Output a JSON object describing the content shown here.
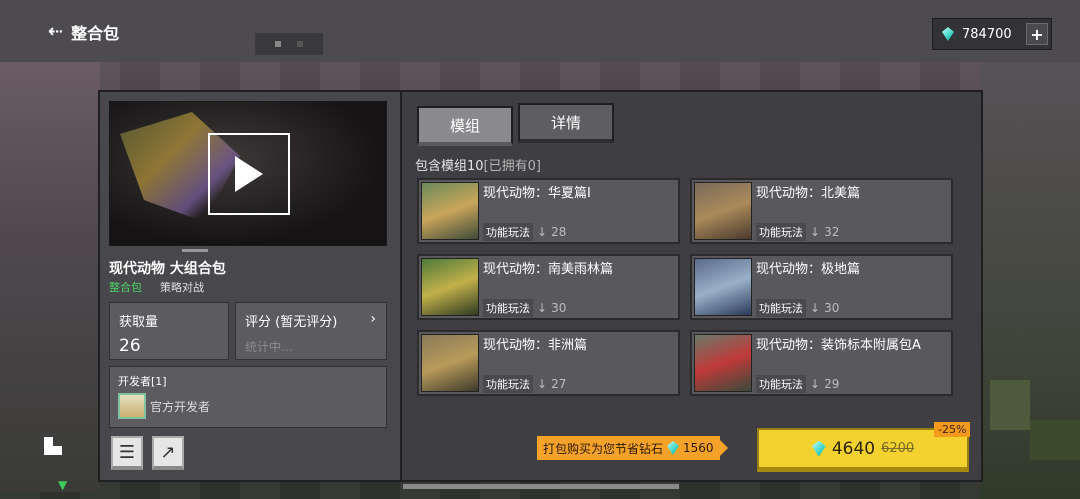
{
  "header": {
    "title": "整合包",
    "back_icon": "back-arrow-icon",
    "currency_value": "784700",
    "add_label": "+"
  },
  "pack": {
    "title": "现代动物 大组合包",
    "tag_type": "整合包",
    "tag_category": "策略对战",
    "downloads_label": "获取量",
    "downloads_value": "26",
    "rating_label": "评分 (暂无评分)",
    "rating_value": "统计中...",
    "developer_label": "开发者[1]",
    "developer_name": "官方开发者"
  },
  "tabs": [
    {
      "label": "模组",
      "active": true
    },
    {
      "label": "详情",
      "active": false
    }
  ],
  "mods_header": {
    "prefix": "包含模组10",
    "owned": "[已拥有0]"
  },
  "mods": [
    {
      "name": "现代动物：华夏篇I",
      "type": "功能玩法",
      "downloads": "28",
      "thumb": [
        "#6a8a5a",
        "#c9a55a",
        "#3e4a3a"
      ]
    },
    {
      "name": "现代动物：北美篇",
      "type": "功能玩法",
      "downloads": "32",
      "thumb": [
        "#7a6a5a",
        "#aa8a5a",
        "#4a3a2e"
      ]
    },
    {
      "name": "现代动物：南美雨林篇",
      "type": "功能玩法",
      "downloads": "30",
      "thumb": [
        "#4e7a3a",
        "#c2b04a",
        "#2e3a22"
      ]
    },
    {
      "name": "现代动物：极地篇",
      "type": "功能玩法",
      "downloads": "30",
      "thumb": [
        "#5a6a8a",
        "#9ab0c8",
        "#2a3a5a"
      ]
    },
    {
      "name": "现代动物：非洲篇",
      "type": "功能玩法",
      "downloads": "27",
      "thumb": [
        "#8a7a5a",
        "#b89a5a",
        "#3e3a2a"
      ]
    },
    {
      "name": "现代动物：装饰标本附属包A",
      "type": "功能玩法",
      "downloads": "29",
      "thumb": [
        "#6a7a6a",
        "#c03a3a",
        "#3a4a3a"
      ]
    }
  ],
  "purchase": {
    "save_text": "打包购买为您节省钻石",
    "save_amount": "1560",
    "price": "4640",
    "old_price": "6200",
    "discount": "-25%"
  },
  "colors": {
    "accent_yellow": "#f3d12f",
    "banner_orange": "#f5a22a",
    "tag_green": "#4fd36a"
  }
}
